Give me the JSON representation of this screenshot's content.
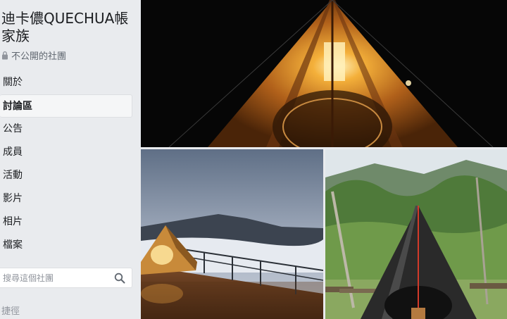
{
  "group": {
    "name": "迪卡儂QUECHUA帳家族",
    "privacy": "不公開的社團"
  },
  "nav": {
    "items": [
      {
        "label": "關於"
      },
      {
        "label": "討論區"
      },
      {
        "label": "公告"
      },
      {
        "label": "成員"
      },
      {
        "label": "活動"
      },
      {
        "label": "影片"
      },
      {
        "label": "相片"
      },
      {
        "label": "檔案"
      }
    ],
    "active": "討論區"
  },
  "search": {
    "placeholder": "搜尋這個社團"
  },
  "shortcuts_label": "捷徑",
  "icons": {
    "lock": "lock-icon",
    "search": "search-icon"
  },
  "colors": {
    "page_bg": "#e9ebee",
    "text": "#1c1e21",
    "muted": "#606770",
    "tent_glow": "#f0a040"
  }
}
